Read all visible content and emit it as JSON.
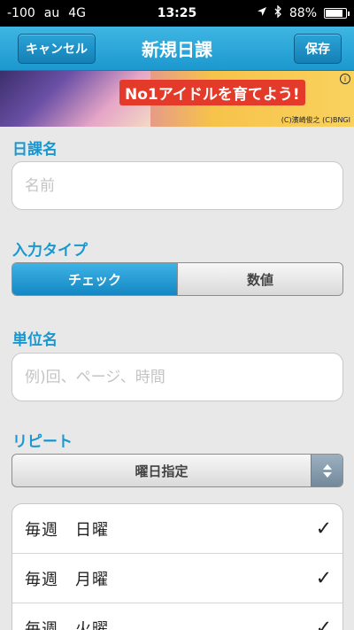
{
  "status_bar": {
    "signal": "-100",
    "carrier": "au",
    "network": "4G",
    "time": "13:25",
    "battery": "88%",
    "battery_level": 0.88,
    "location_icon": "location-arrow-icon",
    "bluetooth_icon": "bluetooth-icon"
  },
  "nav": {
    "title": "新規日課",
    "cancel_label": "キャンセル",
    "save_label": "保存",
    "accent": "#1c98cf"
  },
  "ad": {
    "headline": "No1アイドルを育てよう!",
    "credit": "(C)濱崎俊之 (C)BNGI",
    "info": "i"
  },
  "form": {
    "name_label": "日課名",
    "name_placeholder": "名前",
    "name_value": "",
    "type_label": "入力タイプ",
    "type_options": [
      "チェック",
      "数値"
    ],
    "type_selected": "チェック",
    "unit_label": "単位名",
    "unit_placeholder": "例)回、ページ、時間",
    "unit_value": "",
    "repeat_label": "リピート",
    "repeat_value": "曜日指定"
  },
  "days": [
    {
      "text": "毎週　日曜",
      "checked": true
    },
    {
      "text": "毎週　月曜",
      "checked": true
    },
    {
      "text": "毎週　火曜",
      "checked": true
    }
  ],
  "check_mark": "✓"
}
